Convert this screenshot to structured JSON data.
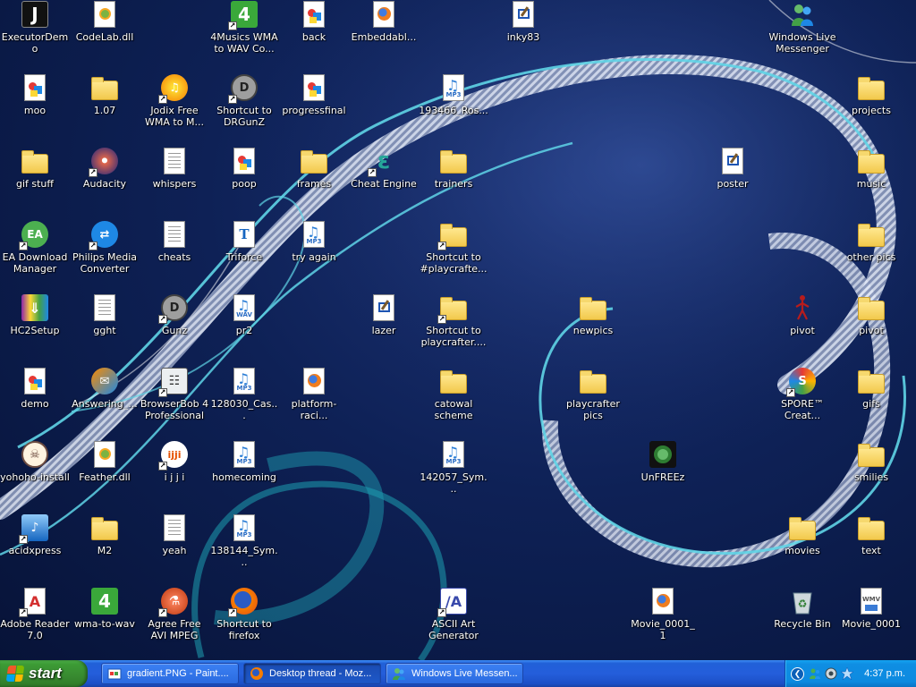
{
  "desktop": {
    "icons": [
      {
        "label": "ExecutorDemo",
        "icon": "executor-demo-icon",
        "kind": "app-j"
      },
      {
        "label": "CodeLab.dll",
        "icon": "dll-file-icon",
        "kind": "dll"
      },
      {
        "label": "4Musics WMA to WAV Co...",
        "icon": "4musics-icon",
        "kind": "4music",
        "shortcut": true
      },
      {
        "label": "back",
        "icon": "image-file-icon",
        "kind": "img"
      },
      {
        "label": "Embeddabl...",
        "icon": "firefox-html-icon",
        "kind": "ffdoc"
      },
      {
        "label": "inky83",
        "icon": "paint-image-icon",
        "kind": "paintdoc"
      },
      {
        "label": "Windows Live Messenger",
        "icon": "messenger-icon",
        "kind": "msn"
      },
      {
        "label": "moo",
        "icon": "image-file-icon",
        "kind": "img"
      },
      {
        "label": "1.07",
        "icon": "folder-icon",
        "kind": "folder"
      },
      {
        "label": "Jodix Free WMA to M...",
        "icon": "jodix-icon",
        "kind": "jodix",
        "shortcut": true
      },
      {
        "label": "Shortcut to DRGunZ",
        "icon": "gunz-icon",
        "kind": "gunz",
        "shortcut": true
      },
      {
        "label": "progressfinal",
        "icon": "image-file-icon",
        "kind": "img"
      },
      {
        "label": "193466_Ros...",
        "icon": "mp3-file-icon",
        "kind": "mp3"
      },
      {
        "label": "projects",
        "icon": "folder-icon",
        "kind": "folder"
      },
      {
        "label": "gif stuff",
        "icon": "folder-icon",
        "kind": "folder"
      },
      {
        "label": "Audacity",
        "icon": "audacity-icon",
        "kind": "audacity",
        "shortcut": true
      },
      {
        "label": "whispers",
        "icon": "text-file-icon",
        "kind": "txt"
      },
      {
        "label": "poop",
        "icon": "image-file-icon",
        "kind": "img"
      },
      {
        "label": "frames",
        "icon": "folder-icon",
        "kind": "folder"
      },
      {
        "label": "Cheat Engine",
        "icon": "cheat-engine-icon",
        "kind": "cheat",
        "shortcut": true
      },
      {
        "label": "trainers",
        "icon": "folder-icon",
        "kind": "folder"
      },
      {
        "label": "poster",
        "icon": "paint-image-icon",
        "kind": "paintdoc"
      },
      {
        "label": "music",
        "icon": "folder-icon",
        "kind": "folder"
      },
      {
        "label": "EA Download Manager",
        "icon": "ea-icon",
        "kind": "ea",
        "shortcut": true
      },
      {
        "label": "Philips Media Converter",
        "icon": "philips-icon",
        "kind": "philips",
        "shortcut": true
      },
      {
        "label": "cheats",
        "icon": "text-file-icon",
        "kind": "txt"
      },
      {
        "label": "Triforce",
        "icon": "font-file-icon",
        "kind": "font"
      },
      {
        "label": "try again",
        "icon": "mp3-file-icon",
        "kind": "mp3"
      },
      {
        "label": "Shortcut to #playcrafte...",
        "icon": "folder-icon",
        "kind": "folder",
        "shortcut": true
      },
      {
        "label": "other pics",
        "icon": "folder-icon",
        "kind": "folder"
      },
      {
        "label": "HC2Setup",
        "icon": "installer-icon",
        "kind": "winrar"
      },
      {
        "label": "gght",
        "icon": "text-file-icon",
        "kind": "txt"
      },
      {
        "label": "Gunz",
        "icon": "gunz-icon",
        "kind": "gunz",
        "shortcut": true
      },
      {
        "label": "pr2",
        "icon": "wav-file-icon",
        "kind": "wav"
      },
      {
        "label": "lazer",
        "icon": "paint-image-icon",
        "kind": "paintdoc"
      },
      {
        "label": "Shortcut to playcrafter....",
        "icon": "folder-icon",
        "kind": "folder",
        "shortcut": true
      },
      {
        "label": "newpics",
        "icon": "folder-icon",
        "kind": "folder"
      },
      {
        "label": "pivot",
        "icon": "pivot-icon",
        "kind": "pivot"
      },
      {
        "label": "pivot",
        "icon": "folder-icon",
        "kind": "folder"
      },
      {
        "label": "demo",
        "icon": "image-file-icon",
        "kind": "img"
      },
      {
        "label": "Answering_...",
        "icon": "answering-icon",
        "kind": "answering"
      },
      {
        "label": "BrowserBob 4 Professional",
        "icon": "browserbob-icon",
        "kind": "bob",
        "shortcut": true
      },
      {
        "label": "128030_Cas...",
        "icon": "mp3-file-icon",
        "kind": "mp3"
      },
      {
        "label": "platform-raci...",
        "icon": "firefox-html-icon",
        "kind": "ffdoc"
      },
      {
        "label": "catowal scheme",
        "icon": "folder-icon",
        "kind": "folder"
      },
      {
        "label": "playcrafter pics",
        "icon": "folder-icon",
        "kind": "folder"
      },
      {
        "label": "SPORE™ Creat...",
        "icon": "spore-icon",
        "kind": "spore",
        "shortcut": true
      },
      {
        "label": "gifs",
        "icon": "folder-icon",
        "kind": "folder"
      },
      {
        "label": "yohoho-install",
        "icon": "yohoho-icon",
        "kind": "yohoho"
      },
      {
        "label": "Feather.dll",
        "icon": "dll-file-icon",
        "kind": "dll"
      },
      {
        "label": "i j j i",
        "icon": "ijji-icon",
        "kind": "ijji",
        "shortcut": true
      },
      {
        "label": "homecoming",
        "icon": "mp3-file-icon",
        "kind": "mp3"
      },
      {
        "label": "142057_Sym...",
        "icon": "mp3-file-icon",
        "kind": "mp3"
      },
      {
        "label": "UnFREEz",
        "icon": "unfreez-icon",
        "kind": "unfreez"
      },
      {
        "label": "smilies",
        "icon": "folder-icon",
        "kind": "folder"
      },
      {
        "label": "acidxpress",
        "icon": "acid-icon",
        "kind": "acid",
        "shortcut": true
      },
      {
        "label": "M2",
        "icon": "folder-icon",
        "kind": "folder"
      },
      {
        "label": "yeah",
        "icon": "text-file-icon",
        "kind": "txt"
      },
      {
        "label": "138144_Sym...",
        "icon": "mp3-file-icon",
        "kind": "mp3"
      },
      {
        "label": "movies",
        "icon": "folder-icon",
        "kind": "folder"
      },
      {
        "label": "text",
        "icon": "folder-icon",
        "kind": "folder"
      },
      {
        "label": "Adobe Reader 7.0",
        "icon": "adobe-reader-icon",
        "kind": "adobe",
        "shortcut": true
      },
      {
        "label": "wma-to-wav",
        "icon": "4musics-icon",
        "kind": "4music"
      },
      {
        "label": "Agree Free AVI MPEG MOV ...",
        "icon": "agree-icon",
        "kind": "agree",
        "shortcut": true
      },
      {
        "label": "Shortcut to firefox",
        "icon": "firefox-icon",
        "kind": "firefox",
        "shortcut": true
      },
      {
        "label": "ASCII Art Generator",
        "icon": "ascii-art-icon",
        "kind": "ascii",
        "shortcut": true
      },
      {
        "label": "Movie_0001_1",
        "icon": "firefox-html-icon",
        "kind": "ffdoc"
      },
      {
        "label": "Recycle Bin",
        "icon": "recycle-bin-icon",
        "kind": "recycle"
      },
      {
        "label": "Movie_0001",
        "icon": "wmv-file-icon",
        "kind": "wmv"
      }
    ]
  },
  "taskbar": {
    "start_label": "start",
    "buttons": [
      {
        "label": "gradient.PNG - Paint....",
        "icon": "paint-icon",
        "active": false
      },
      {
        "label": "Desktop thread - Moz...",
        "icon": "firefox-icon",
        "active": true
      },
      {
        "label": "Windows Live Messen...",
        "icon": "messenger-icon",
        "active": false
      }
    ],
    "tray": {
      "icons": [
        "chevron-left-icon",
        "messenger-tray-icon",
        "volume-icon",
        "network-icon"
      ],
      "clock": "4:37 p.m."
    }
  },
  "colors": {
    "desktop_bg": "#0e2156",
    "swirl_white": "#c8d2e6",
    "swirl_cyan": "#5fd4e6",
    "taskbar_blue": "#245edb",
    "start_green": "#388a30",
    "tray_blue": "#0d8ae0"
  }
}
